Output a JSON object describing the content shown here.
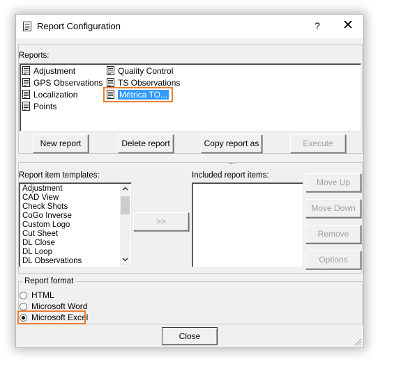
{
  "dialog": {
    "title": "Report Configuration",
    "help_glyph": "?",
    "close_glyph": "✕"
  },
  "reports": {
    "label": "Reports:",
    "items": [
      {
        "label": "Adjustment"
      },
      {
        "label": "GPS Observations"
      },
      {
        "label": "Localization"
      },
      {
        "label": "Points"
      },
      {
        "label": "Quality Control"
      },
      {
        "label": "TS Observations"
      },
      {
        "label": "Métrica TO...",
        "selected": true
      }
    ],
    "buttons": {
      "new": "New report",
      "delete": "Delete report",
      "copy": "Copy report as ...",
      "execute": "Execute"
    }
  },
  "templates": {
    "label": "Report item templates:",
    "items": [
      "Adjustment",
      "CAD View",
      "Check Shots",
      "CoGo Inverse",
      "Custom Logo",
      "Cut Sheet",
      "DL Close",
      "DL Loop",
      "DL Observations"
    ],
    "add_button": ">>"
  },
  "included": {
    "label": "Included report items:",
    "items": []
  },
  "side_buttons": {
    "move_up": "Move Up",
    "move_down": "Move Down",
    "remove": "Remove",
    "options": "Options"
  },
  "format": {
    "label": "Report format",
    "options": [
      {
        "label": "HTML",
        "checked": false
      },
      {
        "label": "Microsoft Word",
        "checked": false
      },
      {
        "label": "Microsoft Excel",
        "checked": true
      }
    ]
  },
  "footer": {
    "close": "Close"
  },
  "colors": {
    "accent_highlight": "#ef7d31",
    "selection": "#3399ff",
    "dialog_bg": "#f0f0f0"
  }
}
